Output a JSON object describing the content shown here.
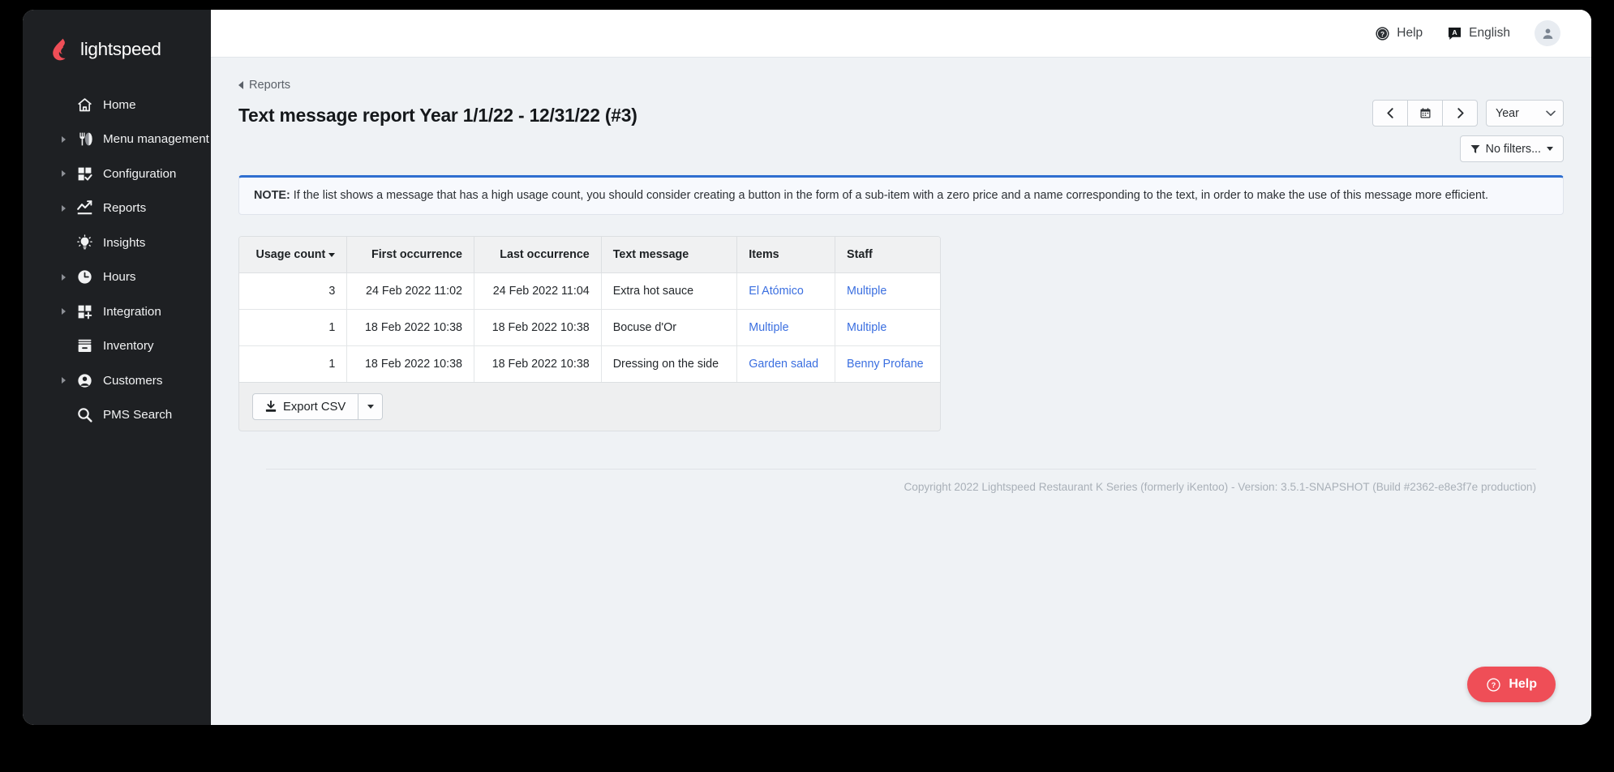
{
  "brand": {
    "name": "lightspeed",
    "logo_icon": "lightspeed-flame-icon"
  },
  "sidebar": {
    "items": [
      {
        "label": "Home",
        "icon": "home-icon",
        "expandable": false
      },
      {
        "label": "Menu management",
        "icon": "menu-management-icon",
        "expandable": true
      },
      {
        "label": "Configuration",
        "icon": "configuration-icon",
        "expandable": true
      },
      {
        "label": "Reports",
        "icon": "reports-chart-icon",
        "expandable": true
      },
      {
        "label": "Insights",
        "icon": "lightbulb-icon",
        "expandable": false
      },
      {
        "label": "Hours",
        "icon": "clock-icon",
        "expandable": true
      },
      {
        "label": "Integration",
        "icon": "integration-icon",
        "expandable": true
      },
      {
        "label": "Inventory",
        "icon": "inventory-box-icon",
        "expandable": false
      },
      {
        "label": "Customers",
        "icon": "customers-person-icon",
        "expandable": true
      },
      {
        "label": "PMS Search",
        "icon": "search-icon",
        "expandable": false
      }
    ]
  },
  "topbar": {
    "help_label": "Help",
    "help_icon": "question-circle-icon",
    "language_label": "English",
    "language_icon": "translate-icon",
    "avatar_icon": "user-avatar-icon"
  },
  "breadcrumb": {
    "label": "Reports",
    "icon": "chevron-left-icon"
  },
  "page": {
    "title": "Text message report Year 1/1/22 - 12/31/22 (#3)"
  },
  "date_nav": {
    "prev_icon": "chevron-left-icon",
    "calendar_icon": "calendar-icon",
    "next_icon": "chevron-right-icon",
    "period_value": "Year",
    "period_options": [
      "Year"
    ],
    "dropdown_icon": "chevron-down-icon"
  },
  "filters": {
    "label": "No filters...",
    "icon": "filter-funnel-icon",
    "caret_icon": "caret-down-icon"
  },
  "note": {
    "prefix": "NOTE:",
    "text": " If the list shows a message that has a high usage count, you should consider creating a button in the form of a sub-item with a zero price and a name corresponding to the text, in order to make the use of this message more efficient."
  },
  "table": {
    "columns": [
      {
        "label": "Usage count",
        "align": "num",
        "sorted": true
      },
      {
        "label": "First occurrence",
        "align": "num",
        "sorted": false
      },
      {
        "label": "Last occurrence",
        "align": "num",
        "sorted": false
      },
      {
        "label": "Text message",
        "align": "text",
        "sorted": false
      },
      {
        "label": "Items",
        "align": "text",
        "sorted": false
      },
      {
        "label": "Staff",
        "align": "text",
        "sorted": false
      }
    ],
    "rows": [
      {
        "usage_count": "3",
        "first_occurrence": "24 Feb 2022 11:02",
        "last_occurrence": "24 Feb 2022 11:04",
        "text_message": "Extra hot sauce",
        "items": "El Atómico",
        "staff": "Multiple"
      },
      {
        "usage_count": "1",
        "first_occurrence": "18 Feb 2022 10:38",
        "last_occurrence": "18 Feb 2022 10:38",
        "text_message": "Bocuse d'Or",
        "items": "Multiple",
        "staff": "Multiple"
      },
      {
        "usage_count": "1",
        "first_occurrence": "18 Feb 2022 10:38",
        "last_occurrence": "18 Feb 2022 10:38",
        "text_message": "Dressing on the side",
        "items": "Garden salad",
        "staff": "Benny Profane"
      }
    ]
  },
  "export": {
    "label": "Export CSV",
    "icon": "download-icon",
    "caret_icon": "caret-down-icon"
  },
  "footer": {
    "copyright": "Copyright 2022 Lightspeed Restaurant K Series (formerly iKentoo) - Version: 3.5.1-SNAPSHOT (Build #2362-e8e3f7e production)"
  },
  "help_widget": {
    "label": "Help",
    "icon": "question-circle-icon"
  },
  "colors": {
    "sidebar_bg": "#1e2023",
    "brand_red": "#ef4e57",
    "page_bg": "#eff2f5",
    "link_blue": "#3b6fe0",
    "note_accent": "#2f6fd0"
  }
}
